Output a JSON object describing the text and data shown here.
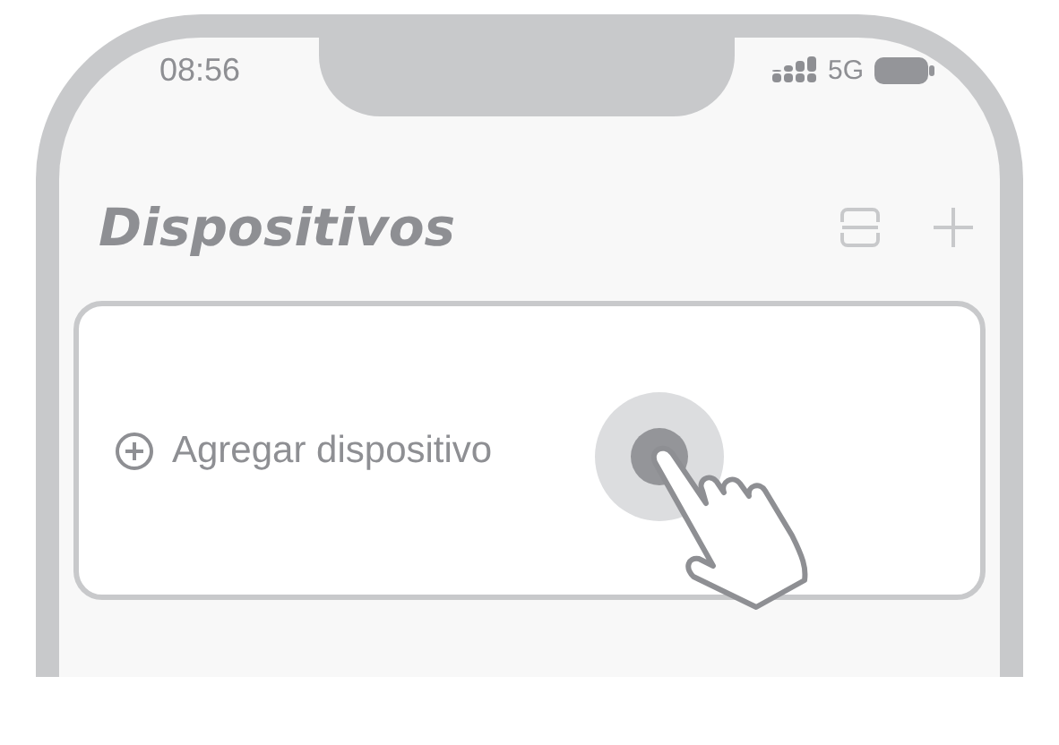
{
  "status_bar": {
    "time": "08:56",
    "network": "5G"
  },
  "header": {
    "title": "Dispositivos"
  },
  "add_device_card": {
    "label": "Agregar dispositivo"
  }
}
